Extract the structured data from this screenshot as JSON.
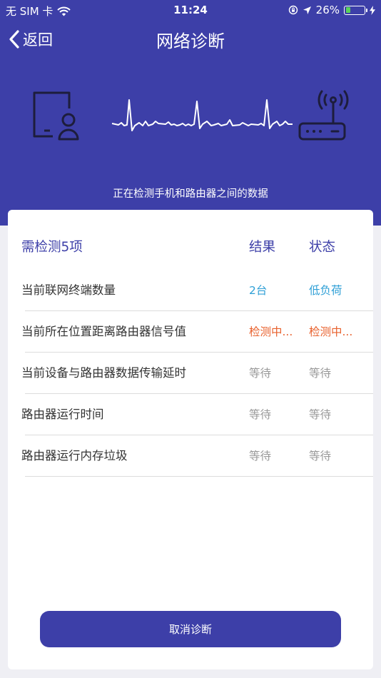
{
  "status_bar": {
    "carrier": "无 SIM 卡",
    "time": "11:24",
    "battery": "26%",
    "battery_level": 0.26
  },
  "nav": {
    "back_label": "返回",
    "title": "网络诊断"
  },
  "hint": "正在检测手机和路由器之间的数据",
  "colors": {
    "brand": "#3d3fa8",
    "result_blue": "#2e9fd6",
    "checking_orange": "#e8602c",
    "waiting_gray": "#9a9a9a"
  },
  "table": {
    "header": {
      "count": "需检测5项",
      "result": "结果",
      "status": "状态"
    },
    "rows": [
      {
        "item": "当前联网终端数量",
        "result": "2台",
        "status": "低负荷",
        "state": "done"
      },
      {
        "item": "当前所在位置距离路由器信号值",
        "result": "检测中...",
        "status": "检测中...",
        "state": "checking"
      },
      {
        "item": "当前设备与路由器数据传输延时",
        "result": "等待",
        "status": "等待",
        "state": "waiting"
      },
      {
        "item": "路由器运行时间",
        "result": "等待",
        "status": "等待",
        "state": "waiting"
      },
      {
        "item": "路由器运行内存垃圾",
        "result": "等待",
        "status": "等待",
        "state": "waiting"
      }
    ]
  },
  "cancel_button": "取消诊断"
}
